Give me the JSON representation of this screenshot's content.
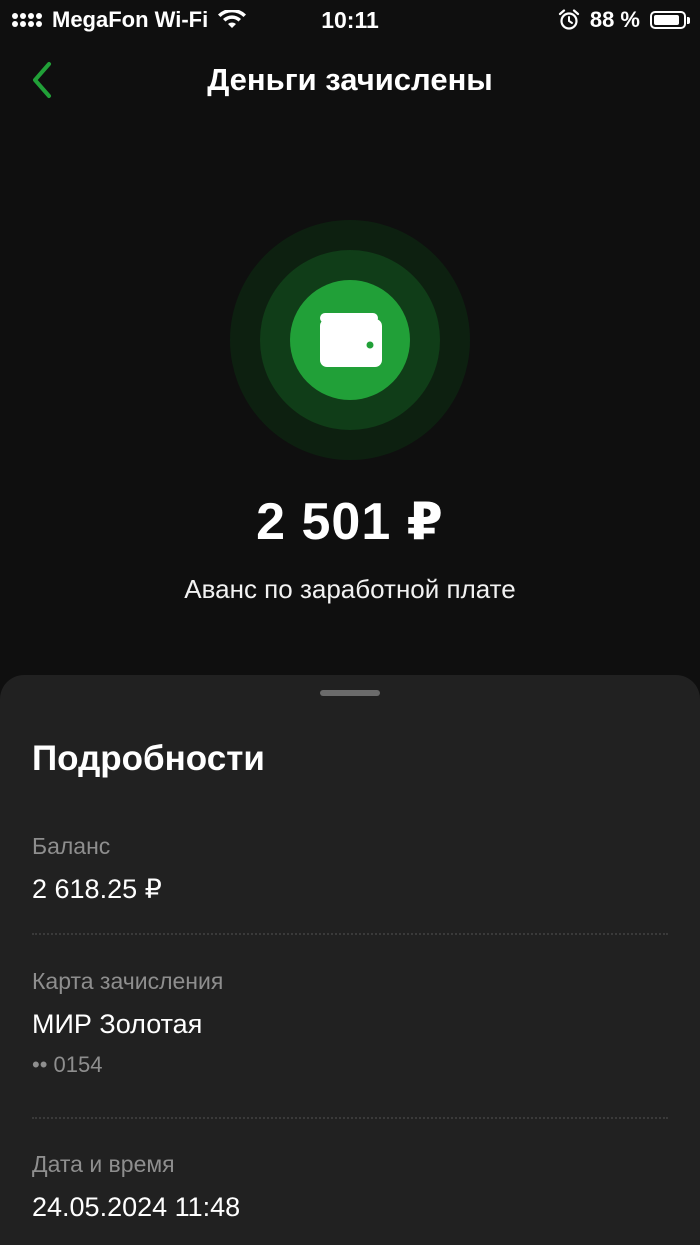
{
  "status_bar": {
    "carrier": "MegaFon Wi-Fi",
    "time": "10:11",
    "battery_percent": "88 %",
    "battery_level": 0.88
  },
  "header": {
    "title": "Деньги зачислены",
    "back_icon": "chevron-left-icon",
    "accent_color": "#21a038"
  },
  "hero": {
    "icon": "wallet-icon",
    "amount": "2 501 ₽",
    "description": "Аванс по заработной плате"
  },
  "details": {
    "title": "Подробности",
    "balance": {
      "label": "Баланс",
      "value": "2 618.25 ₽"
    },
    "card": {
      "label": "Карта зачисления",
      "value": "МИР Золотая",
      "number": "•• 0154"
    },
    "datetime": {
      "label": "Дата и время",
      "value": "24.05.2024 11:48"
    }
  }
}
